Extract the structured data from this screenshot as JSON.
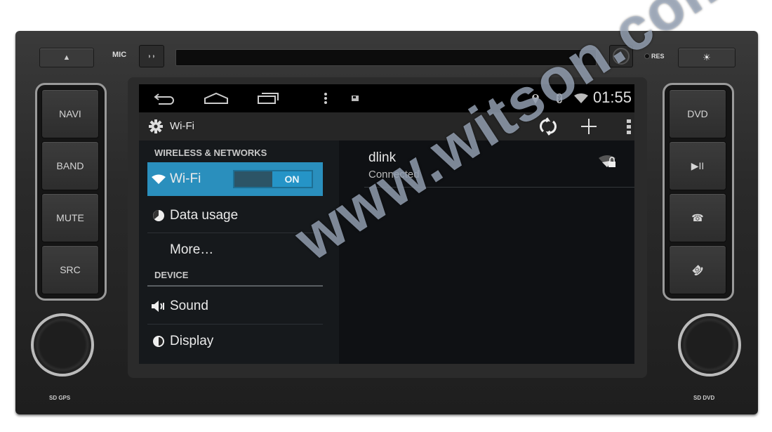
{
  "device": {
    "top": {
      "eject_icon": "▲",
      "mic_label": "MIC",
      "res_label": "RES",
      "brightness_icon": "☀"
    },
    "left_keys": [
      {
        "label": "NAVI"
      },
      {
        "label": "BAND"
      },
      {
        "label": "MUTE"
      },
      {
        "label": "SRC"
      }
    ],
    "right_keys": [
      {
        "label": "DVD"
      },
      {
        "label": "▶II",
        "icon": "play-pause-icon"
      },
      {
        "label": "☎",
        "icon": "call-answer-icon"
      },
      {
        "label": "☎",
        "icon": "call-hangup-icon"
      }
    ],
    "bottom": {
      "left_label": "SD GPS",
      "right_label": "SD DVD"
    }
  },
  "statusbar": {
    "nav_icons": [
      "back-icon",
      "home-icon",
      "recent-apps-icon",
      "menu-icon",
      "notification-icon"
    ],
    "status_icons": [
      "location-icon",
      "bluetooth-icon",
      "wifi-signal-icon"
    ],
    "time": "01:55"
  },
  "actionbar": {
    "title": "Wi-Fi",
    "actions": [
      "wps-icon",
      "add-network-icon",
      "overflow-menu-icon"
    ]
  },
  "settings": {
    "sections": [
      {
        "header": "WIRELESS & NETWORKS",
        "items": [
          {
            "label": "Wi-Fi",
            "icon": "wifi-icon",
            "selected": true,
            "toggle": "ON"
          },
          {
            "label": "Data usage",
            "icon": "data-usage-icon"
          },
          {
            "label": "More…",
            "icon": ""
          }
        ]
      },
      {
        "header": "DEVICE",
        "items": [
          {
            "label": "Sound",
            "icon": "sound-icon"
          },
          {
            "label": "Display",
            "icon": "display-icon"
          }
        ]
      }
    ]
  },
  "networks": [
    {
      "name": "dlink",
      "status": "Connected",
      "secured": true
    }
  ],
  "watermark": "www.witson.com",
  "colors": {
    "accent": "#2a8fbd",
    "toggle_on": "#2594c7",
    "screen_bg": "#111417",
    "statusbar_bg": "#000000"
  }
}
